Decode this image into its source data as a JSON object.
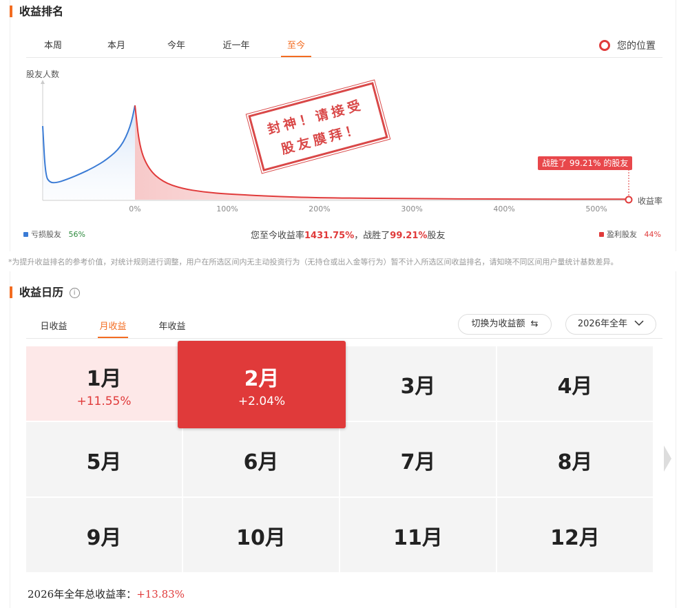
{
  "ranking": {
    "title": "收益排名",
    "tabs": [
      "本周",
      "本月",
      "今年",
      "近一年",
      "至今"
    ],
    "active_tab": 4,
    "my_position_label": "您的位置",
    "callout": "战胜了 99.21% 的股友",
    "loss_label": "亏损股友",
    "loss_pct": "56%",
    "profit_label": "盈利股友",
    "profit_pct": "44%",
    "summary_prefix": "您至今收益率",
    "summary_rate": "1431.75%",
    "summary_mid": "，战胜了",
    "summary_beat": "99.21%",
    "summary_suffix": "股友",
    "stamp_line1": "封神！请接受",
    "stamp_line2": "股友膜拜！",
    "note": "*为提升收益排名的参考价值，对统计规则进行调整，用户在所选区间内无主动投资行为（无持仓或出入金等行为）暂不计入所选区间收益排名，请知晓不同区间用户量统计基数差异。"
  },
  "chart_data": {
    "type": "area",
    "ylabel": "股友人数",
    "xlabel": "收益率",
    "x_ticks": [
      "0%",
      "100%",
      "200%",
      "300%",
      "400%",
      "500%"
    ],
    "x_tick_values": [
      0,
      100,
      200,
      300,
      400,
      500
    ],
    "xlim": [
      -100,
      535
    ],
    "my_return": 535,
    "series": [
      {
        "name": "亏损股友",
        "color": "#3a7bd5",
        "x": [
          -100,
          -97,
          -92,
          -85,
          -75,
          -60,
          -45,
          -30,
          -15,
          -5,
          0
        ],
        "y": [
          0.78,
          0.25,
          0.18,
          0.18,
          0.21,
          0.27,
          0.34,
          0.43,
          0.56,
          0.77,
          1.0
        ]
      },
      {
        "name": "盈利股友",
        "color": "#e03a3a",
        "x": [
          0,
          5,
          15,
          30,
          50,
          75,
          100,
          150,
          200,
          300,
          400,
          535
        ],
        "y": [
          1.0,
          0.55,
          0.32,
          0.19,
          0.12,
          0.08,
          0.06,
          0.035,
          0.02,
          0.01,
          0.006,
          0.005
        ]
      }
    ],
    "colors": {
      "loss": "#3a7bd5",
      "profit": "#e03a3a"
    }
  },
  "calendar": {
    "title": "收益日历",
    "info_icon": "info-icon",
    "tabs": [
      "日收益",
      "月收益",
      "年收益"
    ],
    "active_tab": 1,
    "switch_label": "切换为收益额",
    "year_select": "2026年全年",
    "months": [
      {
        "name": "1月",
        "value": "+11.55%",
        "state": "pos"
      },
      {
        "name": "2月",
        "value": "+2.04%",
        "state": "hl"
      },
      {
        "name": "3月",
        "value": "",
        "state": ""
      },
      {
        "name": "4月",
        "value": "",
        "state": ""
      },
      {
        "name": "5月",
        "value": "",
        "state": ""
      },
      {
        "name": "6月",
        "value": "",
        "state": ""
      },
      {
        "name": "7月",
        "value": "",
        "state": ""
      },
      {
        "name": "8月",
        "value": "",
        "state": ""
      },
      {
        "name": "9月",
        "value": "",
        "state": ""
      },
      {
        "name": "10月",
        "value": "",
        "state": ""
      },
      {
        "name": "11月",
        "value": "",
        "state": ""
      },
      {
        "name": "12月",
        "value": "",
        "state": ""
      }
    ],
    "total_label": "2026年全年总收益率：",
    "total_value": "+13.83%"
  }
}
